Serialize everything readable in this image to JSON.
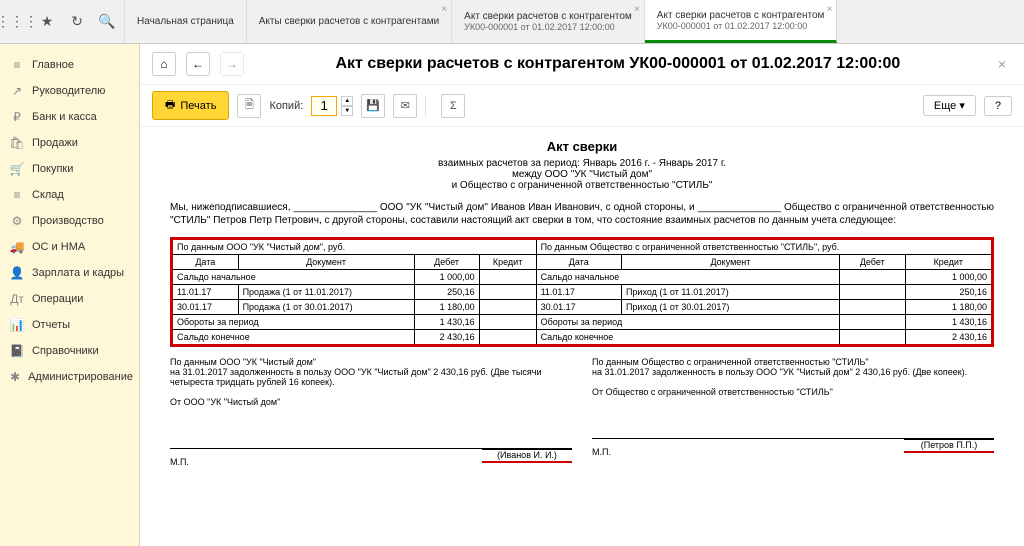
{
  "tabs": [
    {
      "label": "Начальная страница",
      "sub": ""
    },
    {
      "label": "Акты сверки расчетов с контрагентами",
      "sub": ""
    },
    {
      "label": "Акт сверки расчетов с контрагентом",
      "sub": "УК00-000001 от 01.02.2017 12:00:00"
    },
    {
      "label": "Акт сверки расчетов с контрагентом",
      "sub": "УК00-000001 от 01.02.2017 12:00:00"
    }
  ],
  "nav": [
    {
      "icon": "≡",
      "label": "Главное"
    },
    {
      "icon": "↗",
      "label": "Руководителю"
    },
    {
      "icon": "₽",
      "label": "Банк и касса"
    },
    {
      "icon": "🛍",
      "label": "Продажи"
    },
    {
      "icon": "🛒",
      "label": "Покупки"
    },
    {
      "icon": "≡",
      "label": "Склад"
    },
    {
      "icon": "⚙",
      "label": "Производство"
    },
    {
      "icon": "🚚",
      "label": "ОС и НМА"
    },
    {
      "icon": "👤",
      "label": "Зарплата и кадры"
    },
    {
      "icon": "Дт",
      "label": "Операции"
    },
    {
      "icon": "📊",
      "label": "Отчеты"
    },
    {
      "icon": "📓",
      "label": "Справочники"
    },
    {
      "icon": "✱",
      "label": "Администрирование"
    }
  ],
  "header": {
    "title": "Акт сверки расчетов с контрагентом УК00-000001 от 01.02.2017 12:00:00"
  },
  "toolbar": {
    "print": "Печать",
    "copies_label": "Копий:",
    "copies_value": "1",
    "sigma": "Σ",
    "more": "Еще",
    "help": "?"
  },
  "doc": {
    "title": "Акт сверки",
    "line1": "взаимных расчетов за период: Январь 2016 г. - Январь 2017 г.",
    "line2": "между ООО \"УК \"Чистый дом\"",
    "line3": "и Общество с ограниченной ответственностью \"СТИЛЬ\"",
    "para": "Мы, нижеподписавшиеся, _______________ ООО \"УК \"Чистый дом\" Иванов Иван Иванович, с одной стороны, и _______________ Общество с ограниченной ответственностью \"СТИЛЬ\" Петров Петр Петрович, с другой стороны, составили настоящий акт сверки в том, что состояние взаимных расчетов по данным учета следующее:",
    "hdr_left": "По данным ООО \"УК \"Чистый дом\", руб.",
    "hdr_right": "По данным Общество с ограниченной ответственностью \"СТИЛЬ\", руб.",
    "col_date": "Дата",
    "col_doc": "Документ",
    "col_debit": "Дебет",
    "col_credit": "Кредит",
    "saldo_start": "Сальдо начальное",
    "saldo_start_val": "1 000,00",
    "rows_left": [
      {
        "date": "11.01.17",
        "doc": "Продажа (1 от 11.01.2017)",
        "debit": "250,16",
        "credit": ""
      },
      {
        "date": "30.01.17",
        "doc": "Продажа (1 от 30.01.2017)",
        "debit": "1 180,00",
        "credit": ""
      }
    ],
    "rows_right": [
      {
        "date": "11.01.17",
        "doc": "Приход (1 от 11.01.2017)",
        "debit": "",
        "credit": "250,16"
      },
      {
        "date": "30.01.17",
        "doc": "Приход (1 от 30.01.2017)",
        "debit": "",
        "credit": "1 180,00"
      }
    ],
    "turnover": "Обороты за период",
    "turnover_val": "1 430,16",
    "saldo_end": "Сальдо конечное",
    "saldo_end_val": "2 430,16",
    "footer_left_1": "По данным ООО \"УК \"Чистый дом\"",
    "footer_left_2": "на 31.01.2017 задолженность в пользу ООО \"УК \"Чистый дом\" 2 430,16 руб. (Две тысячи четыреста тридцать рублей 16 копеек).",
    "footer_left_3": "От ООО \"УК \"Чистый дом\"",
    "footer_right_1": "По данным Общество с ограниченной ответственностью \"СТИЛЬ\"",
    "footer_right_2": "на 31.01.2017 задолженность в пользу ООО \"УК \"Чистый дом\" 2 430,16 руб. (Две копеек).",
    "footer_right_3": "От Общество с ограниченной ответственностью \"СТИЛЬ\"",
    "sig_left": "(Иванов И. И.)",
    "sig_right": "(Петров П.П.)",
    "mp": "М.П."
  }
}
